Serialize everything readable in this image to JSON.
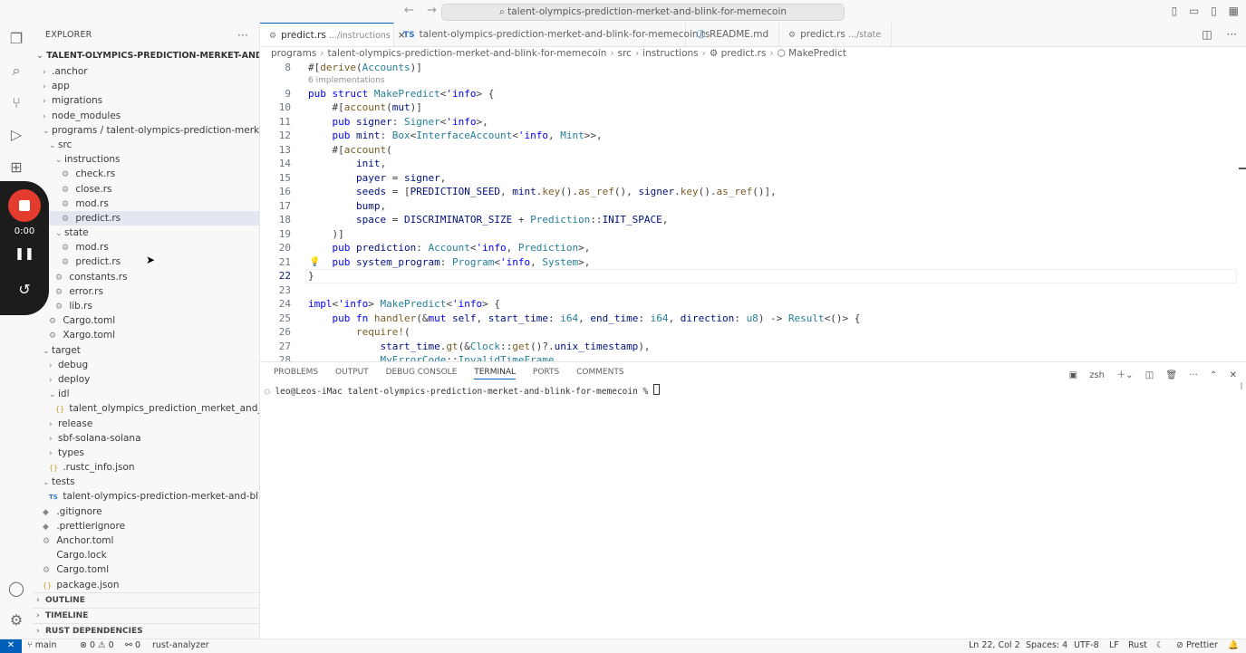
{
  "titlebar": {
    "back": "←",
    "forward": "→",
    "search": "⌕ talent-olympics-prediction-merket-and-blink-for-memecoin"
  },
  "explorer": {
    "title": "EXPLORER",
    "more": "···",
    "root": "TALENT-OLYMPICS-PREDICTION-MERKET-AND-BLINK-...",
    "items": [
      {
        "label": ".anchor",
        "chev": "›",
        "icon": ""
      },
      {
        "label": "app",
        "chev": "›",
        "icon": ""
      },
      {
        "label": "migrations",
        "chev": "›",
        "icon": ""
      },
      {
        "label": "node_modules",
        "chev": "›",
        "icon": ""
      },
      {
        "label": "programs / talent-olympics-prediction-merket-an...",
        "chev": "⌄",
        "icon": ""
      },
      {
        "label": "src",
        "chev": "⌄",
        "icon": ""
      },
      {
        "label": "instructions",
        "chev": "⌄",
        "icon": ""
      },
      {
        "label": "check.rs",
        "chev": "",
        "icon": "⚙"
      },
      {
        "label": "close.rs",
        "chev": "",
        "icon": "⚙"
      },
      {
        "label": "mod.rs",
        "chev": "",
        "icon": "⚙"
      },
      {
        "label": "predict.rs",
        "chev": "",
        "icon": "⚙"
      },
      {
        "label": "state",
        "chev": "⌄",
        "icon": ""
      },
      {
        "label": "mod.rs",
        "chev": "",
        "icon": "⚙"
      },
      {
        "label": "predict.rs",
        "chev": "",
        "icon": "⚙"
      },
      {
        "label": "constants.rs",
        "chev": "",
        "icon": "⚙"
      },
      {
        "label": "error.rs",
        "chev": "",
        "icon": "⚙"
      },
      {
        "label": "lib.rs",
        "chev": "",
        "icon": "⚙"
      },
      {
        "label": "Cargo.toml",
        "chev": "",
        "icon": "⚙"
      },
      {
        "label": "Xargo.toml",
        "chev": "",
        "icon": "⚙"
      },
      {
        "label": "target",
        "chev": "⌄",
        "icon": ""
      },
      {
        "label": "debug",
        "chev": "›",
        "icon": ""
      },
      {
        "label": "deploy",
        "chev": "›",
        "icon": ""
      },
      {
        "label": "idl",
        "chev": "⌄",
        "icon": ""
      },
      {
        "label": "talent_olympics_prediction_merket_and_blink...",
        "chev": "",
        "icon": "{}"
      },
      {
        "label": "release",
        "chev": "›",
        "icon": ""
      },
      {
        "label": "sbf-solana-solana",
        "chev": "›",
        "icon": ""
      },
      {
        "label": "types",
        "chev": "›",
        "icon": ""
      },
      {
        "label": ".rustc_info.json",
        "chev": "",
        "icon": "{}"
      },
      {
        "label": "tests",
        "chev": "⌄",
        "icon": ""
      },
      {
        "label": "talent-olympics-prediction-merket-and-blink-f...",
        "chev": "",
        "icon": "TS"
      },
      {
        "label": ".gitignore",
        "chev": "",
        "icon": "◆"
      },
      {
        "label": ".prettierignore",
        "chev": "",
        "icon": "◆"
      },
      {
        "label": "Anchor.toml",
        "chev": "",
        "icon": "⚙"
      },
      {
        "label": "Cargo.lock",
        "chev": "",
        "icon": ""
      },
      {
        "label": "Cargo.toml",
        "chev": "",
        "icon": "⚙"
      },
      {
        "label": "package.json",
        "chev": "",
        "icon": "{}"
      }
    ],
    "sections": [
      "OUTLINE",
      "TIMELINE",
      "RUST DEPENDENCIES"
    ]
  },
  "recorder": {
    "time": "0:00",
    "pause": "❚❚",
    "restart": "↺"
  },
  "tabs": [
    {
      "label": "predict.rs",
      "desc": ".../instructions",
      "icon": "⚙",
      "close": "×"
    },
    {
      "label": "talent-olympics-prediction-merket-and-blink-for-memecoin.ts",
      "desc": "",
      "icon": "TS",
      "close": ""
    },
    {
      "label": "README.md",
      "desc": "",
      "icon": "ⓘ",
      "close": ""
    },
    {
      "label": "predict.rs",
      "desc": ".../state",
      "icon": "⚙",
      "close": ""
    }
  ],
  "breadcrumb": [
    "programs",
    "talent-olympics-prediction-merket-and-blink-for-memecoin",
    "src",
    "instructions",
    "⚙ predict.rs",
    "⬡ MakePredict"
  ],
  "editor": {
    "codelens": "6 implementations",
    "lines": [
      {
        "n": "8",
        "html": "#[<span class=\"f\">derive</span>(<span class=\"t\">Accounts</span>)]"
      },
      {
        "n": "9",
        "html": "<span class=\"k\">pub struct</span> <span class=\"t\">MakePredict</span>&lt;<span class=\"k\">'info</span>&gt; {"
      },
      {
        "n": "10",
        "html": "    #[<span class=\"f\">account</span>(<span class=\"v\">mut</span>)]"
      },
      {
        "n": "11",
        "html": "    <span class=\"k\">pub</span> <span class=\"v\">signer</span>: <span class=\"t\">Signer</span>&lt;<span class=\"k\">'info</span>&gt;,"
      },
      {
        "n": "12",
        "html": "    <span class=\"k\">pub</span> <span class=\"v\">mint</span>: <span class=\"t\">Box</span>&lt;<span class=\"t\">InterfaceAccount</span>&lt;<span class=\"k\">'info</span>, <span class=\"t\">Mint</span>&gt;&gt;,"
      },
      {
        "n": "13",
        "html": "    #[<span class=\"f\">account</span>("
      },
      {
        "n": "14",
        "html": "        <span class=\"v\">init</span>,"
      },
      {
        "n": "15",
        "html": "        <span class=\"v\">payer</span> = <span class=\"v\">signer</span>,"
      },
      {
        "n": "16",
        "html": "        <span class=\"v\">seeds</span> = [<span class=\"v\">PREDICTION_SEED</span>, <span class=\"v\">mint</span>.<span class=\"f\">key</span>().<span class=\"f\">as_ref</span>(), <span class=\"v\">signer</span>.<span class=\"f\">key</span>().<span class=\"f\">as_ref</span>()],"
      },
      {
        "n": "17",
        "html": "        <span class=\"v\">bump</span>,"
      },
      {
        "n": "18",
        "html": "        <span class=\"v\">space</span> = <span class=\"v\">DISCRIMINATOR_SIZE</span> + <span class=\"t\">Prediction</span>::<span class=\"v\">INIT_SPACE</span>,"
      },
      {
        "n": "19",
        "html": "    )]"
      },
      {
        "n": "20",
        "html": "    <span class=\"k\">pub</span> <span class=\"v\">prediction</span>: <span class=\"t\">Account</span>&lt;<span class=\"k\">'info</span>, <span class=\"t\">Prediction</span>&gt;,"
      },
      {
        "n": "21",
        "html": "    <span class=\"k\">pub</span> <span class=\"v\">system_program</span>: <span class=\"t\">Program</span>&lt;<span class=\"k\">'info</span>, <span class=\"t\">System</span>&gt;,"
      },
      {
        "n": "22",
        "html": "}"
      },
      {
        "n": "23",
        "html": ""
      },
      {
        "n": "24",
        "html": "<span class=\"k\">impl</span>&lt;<span class=\"k\">'info</span>&gt; <span class=\"t\">MakePredict</span>&lt;<span class=\"k\">'info</span>&gt; {"
      },
      {
        "n": "25",
        "html": "    <span class=\"k\">pub fn</span> <span class=\"f\">handler</span>(&amp;<span class=\"k\">mut</span> <span class=\"v\">self</span>, <span class=\"v\">start_time</span>: <span class=\"t\">i64</span>, <span class=\"v\">end_time</span>: <span class=\"t\">i64</span>, <span class=\"v\">direction</span>: <span class=\"t\">u8</span>) -&gt; <span class=\"t\">Result</span>&lt;()&gt; {"
      },
      {
        "n": "26",
        "html": "        <span class=\"f\">require!</span>("
      },
      {
        "n": "27",
        "html": "            <span class=\"v\">start_time</span>.<span class=\"f\">gt</span>(&amp;<span class=\"t\">Clock</span>::<span class=\"f\">get</span>()?.<span class=\"v\">unix_timestamp</span>),"
      },
      {
        "n": "28",
        "html": "            <span class=\"t\">MyErrorCode</span>::<span class=\"t\">InvalidTimeFrame</span>,"
      }
    ]
  },
  "panel": {
    "tabs": [
      "PROBLEMS",
      "OUTPUT",
      "DEBUG CONSOLE",
      "TERMINAL",
      "PORTS",
      "COMMENTS"
    ],
    "shell": "zsh",
    "prompt": "leo@Leos-iMac talent-olympics-prediction-merket-and-blink-for-memecoin % "
  },
  "status": {
    "branch": "main",
    "errors": "⊗ 0 ⚠ 0",
    "ports": "⚯ 0",
    "analyzer": "rust-analyzer",
    "position": "Ln 22, Col 2",
    "spaces": "Spaces: 4",
    "encoding": "UTF-8",
    "eol": "LF",
    "language": "Rust",
    "prettier": "Prettier"
  }
}
